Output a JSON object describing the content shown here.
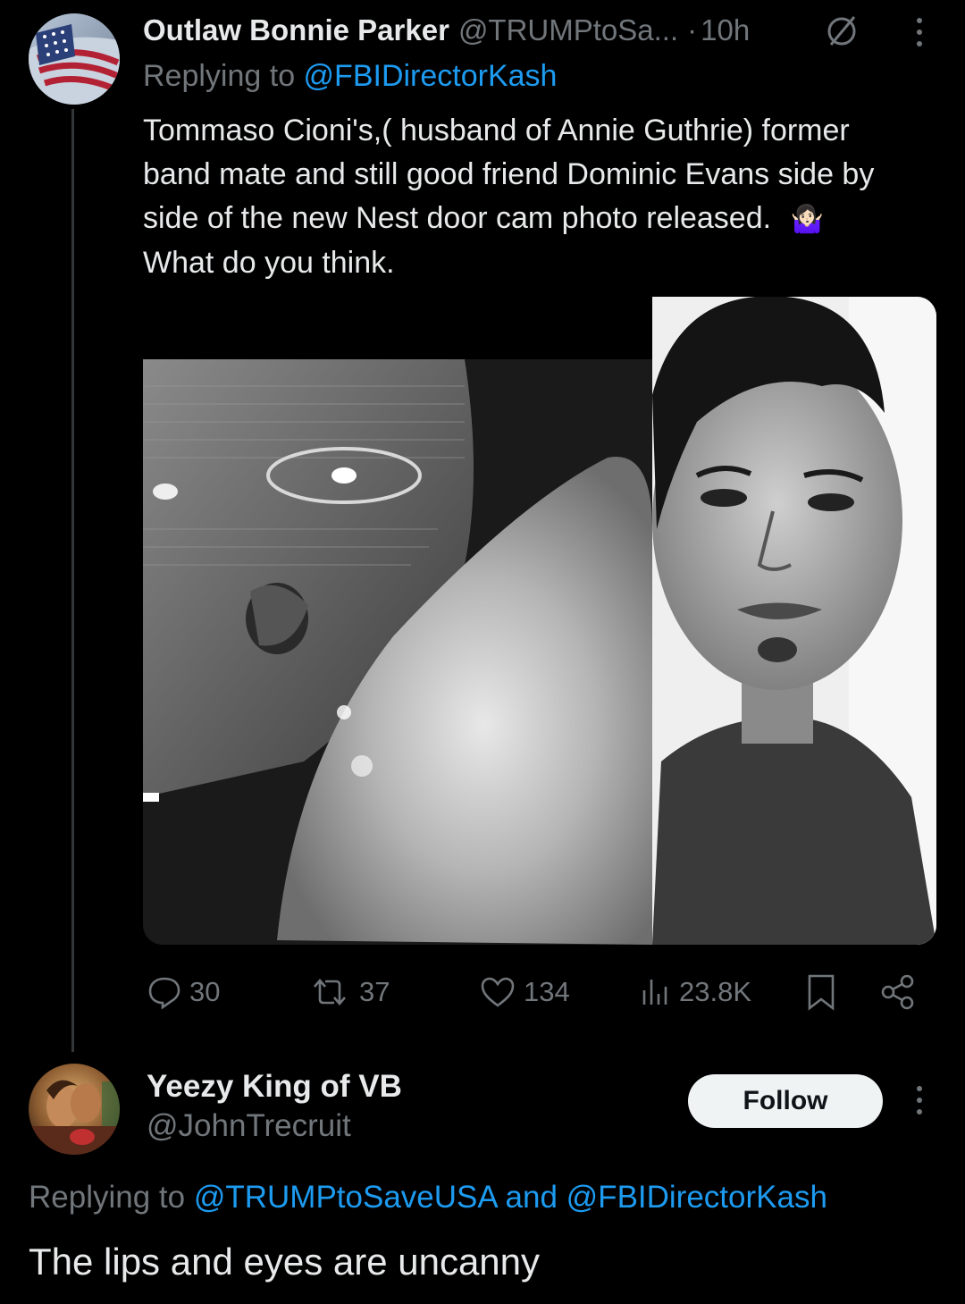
{
  "post": {
    "display_name": "Outlaw Bonnie Parker",
    "handle": "@TRUMPtoSa...",
    "separator": "·",
    "time": "10h",
    "replying_prefix": "Replying to ",
    "replying_handle": "@FBIDirectorKash",
    "text_line1": "Tommaso Cioni's,( husband of Annie Guthrie) former",
    "text_line2": "band mate and still good friend Dominic Evans side by",
    "text_line3": "side of the new Nest door cam photo released.",
    "text_emoji": "🤷🏻‍♀️",
    "text_line4": "What do you think.",
    "actions": {
      "replies": "30",
      "reposts": "37",
      "likes": "134",
      "views": "23.8K"
    }
  },
  "reply": {
    "display_name": "Yeezy King of VB",
    "handle": "@JohnTrecruit",
    "follow_label": "Follow",
    "replying_prefix": "Replying to ",
    "replying_handle1": "@TRUMPtoSaveUSA",
    "replying_and": " and ",
    "replying_handle2": "@FBIDirectorKash",
    "text": "The lips and eyes are uncanny"
  },
  "colors": {
    "background": "#000000",
    "text": "#e7e9ea",
    "muted": "#71767b",
    "link": "#1d9bf0",
    "follow_bg": "#eff3f4"
  },
  "icons": [
    "flag-avatar",
    "mute-icon",
    "more-icon",
    "reply-icon",
    "repost-icon",
    "like-icon",
    "views-icon",
    "bookmark-icon",
    "share-icon"
  ]
}
